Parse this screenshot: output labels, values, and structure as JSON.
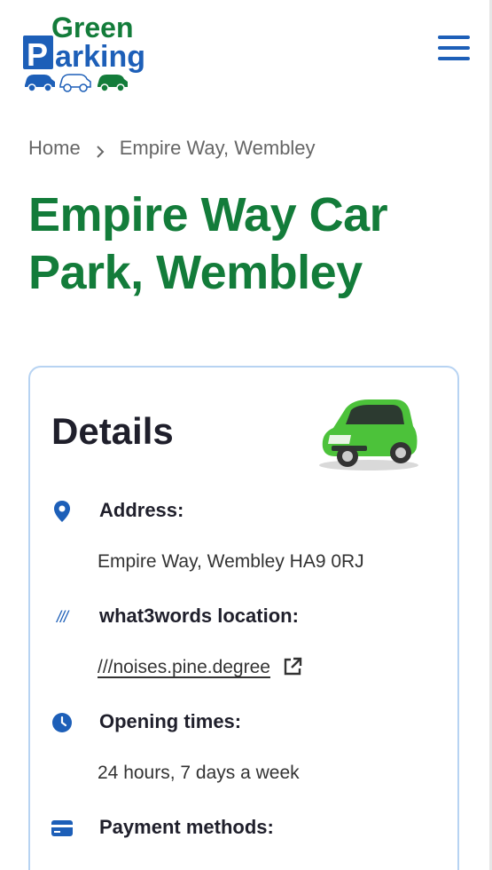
{
  "header": {
    "logo": {
      "line1": "Green",
      "line2": "Parking",
      "p_letter": "P",
      "rest": "arking"
    },
    "menu_icon": "hamburger-icon"
  },
  "breadcrumb": {
    "home": "Home",
    "current": "Empire Way, Wembley",
    "separator_icon": "chevron-right-icon"
  },
  "page": {
    "title": "Empire Way Car Park, Wembley"
  },
  "details": {
    "title": "Details",
    "items": [
      {
        "icon": "location-pin-icon",
        "label": "Address:",
        "value": "Empire Way, Wembley HA9 0RJ"
      },
      {
        "icon": "what3words-icon",
        "icon_text": "///",
        "label": "what3words location:",
        "value": "///noises.pine.degree",
        "link_icon": "external-link-icon"
      },
      {
        "icon": "clock-icon",
        "label": "Opening times:",
        "value": "24 hours, 7 days a week"
      },
      {
        "icon": "credit-card-icon",
        "label": "Payment methods:"
      }
    ]
  },
  "colors": {
    "brand_green": "#137c3a",
    "brand_blue": "#1d5fb8",
    "card_border": "#b7d3f2"
  }
}
